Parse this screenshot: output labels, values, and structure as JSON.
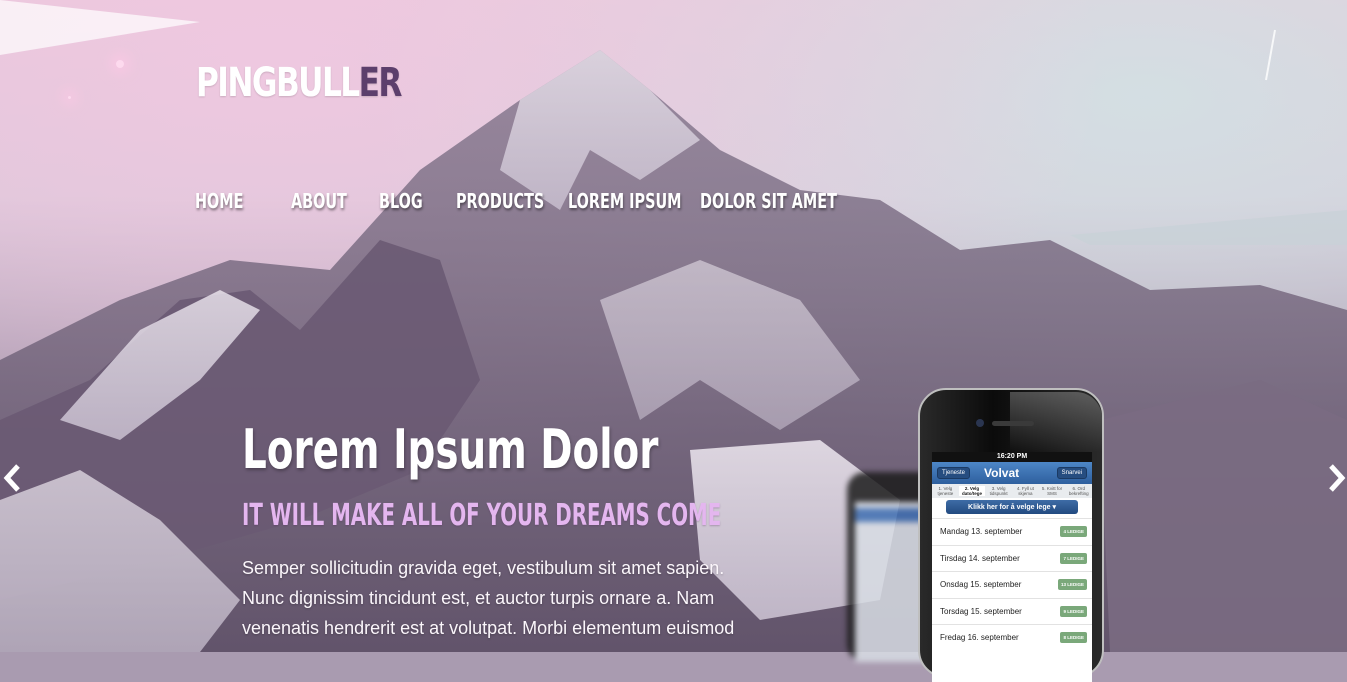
{
  "brand": {
    "logo_main": "PINGBULL",
    "logo_accent": "ER"
  },
  "nav": {
    "items": [
      {
        "label": "HOME"
      },
      {
        "label": "ABOUT"
      },
      {
        "label": "BLOG"
      },
      {
        "label": "PRODUCTS"
      },
      {
        "label": "LOREM IPSUM"
      },
      {
        "label": "DOLOR SIT AMET"
      }
    ]
  },
  "hero": {
    "title": "Lorem Ipsum Dolor",
    "subtitle": "IT WILL MAKE ALL OF YOUR DREAMS COME",
    "body": "Semper sollicitudin gravida eget, vestibulum sit amet sapien. Nunc dignissim tincidunt est, et auctor turpis ornare a. Nam venenatis hendrerit est at volutpat. Morbi elementum euismod"
  },
  "slider": {
    "prev_icon": "chevron-left-icon",
    "next_icon": "chevron-right-icon"
  },
  "phone": {
    "time": "16:20 PM",
    "back_button": "Tjeneste",
    "brand": "Volvat",
    "right_button": "Snarvei",
    "steps": [
      "1. Velg tjeneste",
      "2. Velg dato/tege",
      "3. Velg tidspunkt",
      "4. Fyll ut skjema",
      "5. Kvitt for SMS",
      "6. Ord bekrefting"
    ],
    "select_label": "Klikk her for å velge lege",
    "days": [
      {
        "label": "Mandag 13. september",
        "badge": "4 LEDIGE"
      },
      {
        "label": "Tirsdag 14. september",
        "badge": "7 LEDIGE"
      },
      {
        "label": "Onsdag 15. september",
        "badge": "13 LEDIGE"
      },
      {
        "label": "Torsdag 15. september",
        "badge": "9 LEDIGE"
      },
      {
        "label": "Fredag 16. september",
        "badge": "8 LEDIGE"
      }
    ]
  },
  "colors": {
    "accent": "#5c3f6c",
    "tagline": "#e4b6ef",
    "badge": "#7aa87a",
    "appbar": "#3a6fb0"
  }
}
